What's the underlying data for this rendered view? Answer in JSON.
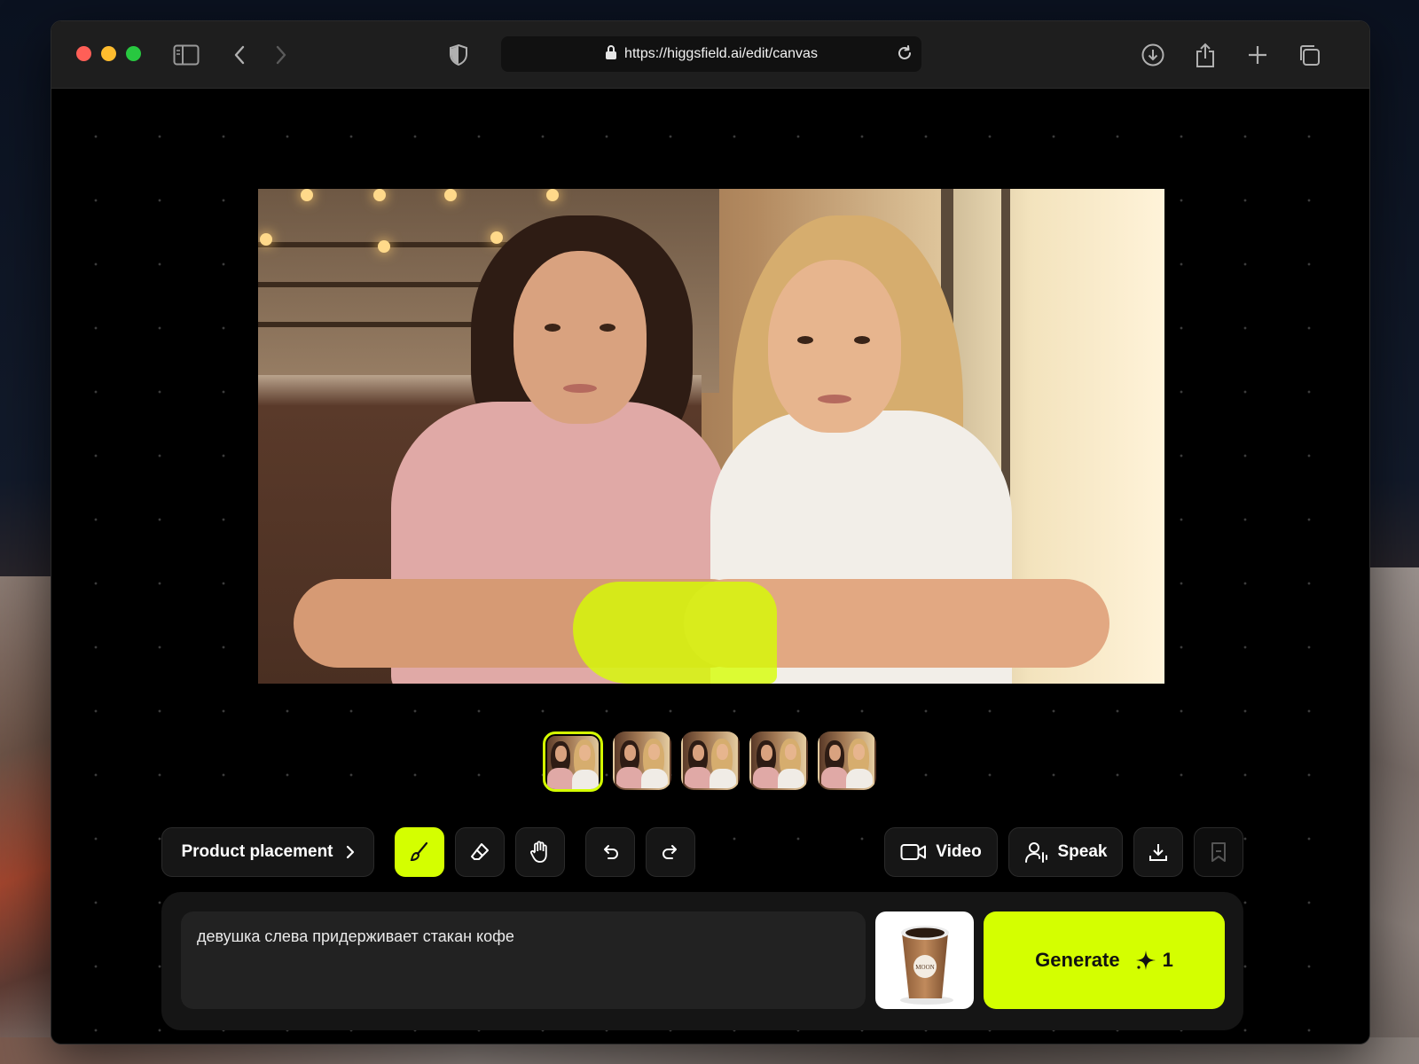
{
  "browser": {
    "url": "https://higgsfield.ai/edit/canvas",
    "traffic_colors": [
      "#ff5f57",
      "#febc2e",
      "#28c840"
    ]
  },
  "editor": {
    "accent_color": "#d4ff00",
    "thumbnails": [
      {
        "active": true
      },
      {
        "active": false
      },
      {
        "active": false
      },
      {
        "active": false
      },
      {
        "active": false
      }
    ],
    "toolbar": {
      "mode_label": "Product placement",
      "video_label": "Video",
      "speak_label": "Speak",
      "tools": [
        "brush-icon",
        "eraser-icon",
        "hand-icon",
        "undo-icon",
        "redo-icon",
        "download-icon",
        "bookmark-icon"
      ]
    },
    "prompt": {
      "text": "девушка слева придерживает стакан кофе"
    },
    "product_image": {
      "cup_text": "MOON"
    },
    "generate": {
      "label": "Generate",
      "cost": "1"
    }
  }
}
